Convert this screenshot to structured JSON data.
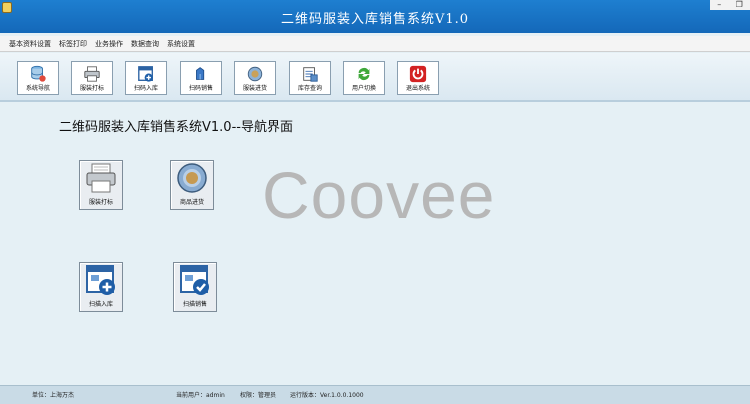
{
  "window": {
    "title": "二维码服装入库销售系统V1.0",
    "minimize": "–",
    "restore": "❐"
  },
  "menu": [
    "基本资料设置",
    "标签打印",
    "业务操作",
    "数据查询",
    "系统设置"
  ],
  "toolbar": [
    {
      "label": "系统导航",
      "icon": "database-icon"
    },
    {
      "label": "服装打标",
      "icon": "printer-icon"
    },
    {
      "label": "扫码入库",
      "icon": "scan-in-icon"
    },
    {
      "label": "扫码销售",
      "icon": "scan-sale-icon"
    },
    {
      "label": "服装进货",
      "icon": "purchase-icon"
    },
    {
      "label": "库存查询",
      "icon": "inventory-icon"
    },
    {
      "label": "用户切换",
      "icon": "refresh-icon"
    },
    {
      "label": "退出系统",
      "icon": "power-icon"
    }
  ],
  "main": {
    "heading": "二维码服装入库销售系统V1.0--导航界面",
    "watermark": "Coovee",
    "buttons": [
      {
        "label": "服装打标",
        "icon": "printer-icon"
      },
      {
        "label": "商品进货",
        "icon": "purchase-icon"
      },
      {
        "label": "扫描入库",
        "icon": "scan-in-icon"
      },
      {
        "label": "扫描销售",
        "icon": "scan-sale-icon"
      }
    ]
  },
  "status": {
    "unit": "单位：上海万杰",
    "user": "当前用户：admin",
    "role": "权限：管理员",
    "version": "运行版本：Ver.1.0.0.1000"
  },
  "colors": {
    "titlebar": "#1468b9",
    "background": "#e5f0f5",
    "statusbar": "#c9dbe6"
  }
}
